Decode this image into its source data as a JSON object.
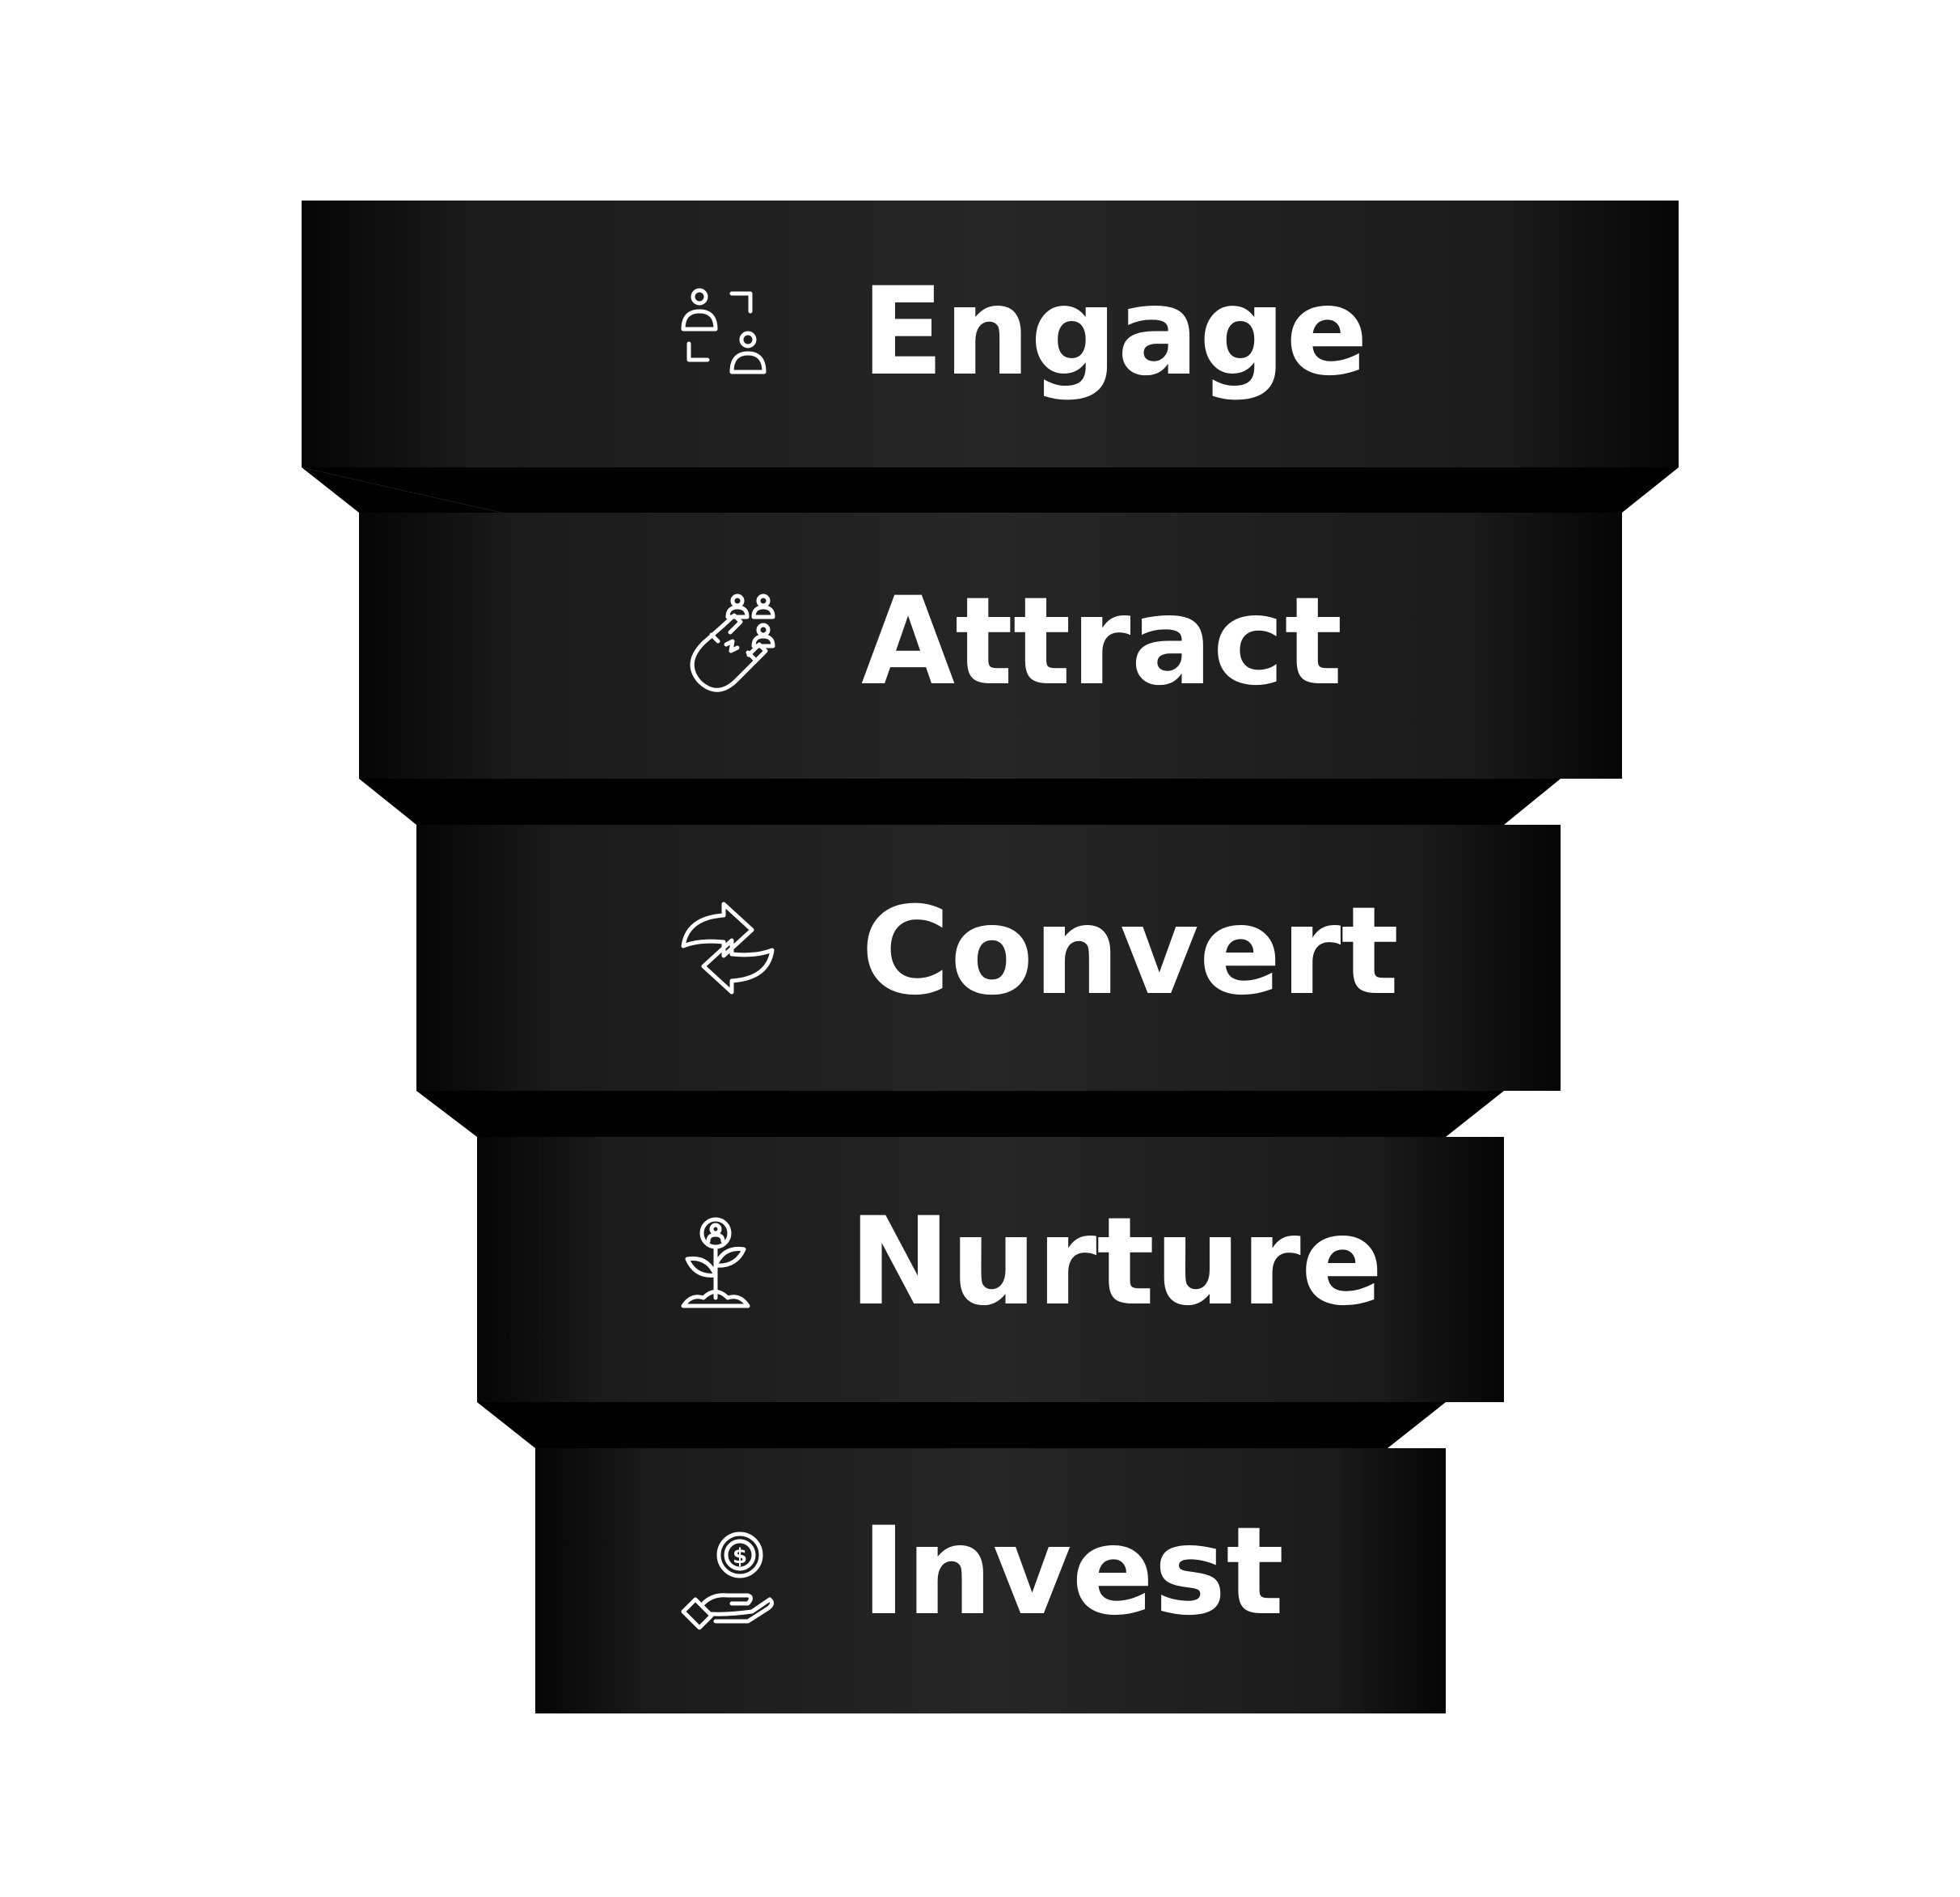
{
  "diagram": {
    "type": "funnel",
    "stages": [
      {
        "label": "Engage",
        "icon": "people-exchange-icon"
      },
      {
        "label": "Attract",
        "icon": "magnet-people-icon"
      },
      {
        "label": "Convert",
        "icon": "convert-arrows-icon"
      },
      {
        "label": "Nurture",
        "icon": "growing-plant-person-icon"
      },
      {
        "label": "Invest",
        "icon": "hand-coin-icon"
      }
    ]
  },
  "colors": {
    "background": "#ffffff",
    "band_edge": "#050505",
    "band_center": "#262626",
    "connector": "#000000",
    "text": "#ffffff"
  }
}
